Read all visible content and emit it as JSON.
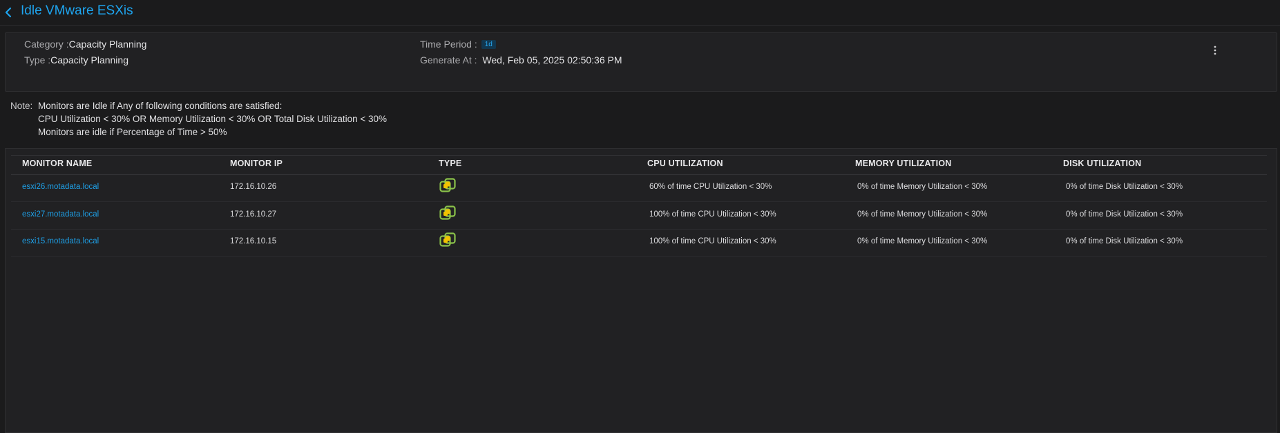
{
  "header": {
    "title": "Idle VMware ESXis"
  },
  "info": {
    "category_label": "Category :",
    "category_value": "Capacity Planning",
    "type_label": "Type :",
    "type_value": "Capacity Planning",
    "time_period_label": "Time Period :",
    "time_period_value": "1d",
    "generated_label": "Generate At :",
    "generated_value": "Wed, Feb 05, 2025 02:50:36 PM"
  },
  "note": {
    "label": "Note:",
    "lines": [
      "Monitors are Idle if Any of following conditions are satisfied:",
      "CPU Utilization < 30% OR Memory Utilization < 30% OR Total Disk Utilization < 30%",
      "Monitors are idle if Percentage of Time > 50%"
    ]
  },
  "table": {
    "columns": [
      "MONITOR NAME",
      "MONITOR IP",
      "TYPE",
      "CPU UTILIZATION",
      "MEMORY UTILIZATION",
      "DISK UTILIZATION"
    ],
    "rows": [
      {
        "name": "esxi26.motadata.local",
        "ip": "172.16.10.26",
        "type_icon": "vmware-icon",
        "cpu": "60% of time CPU Utilization < 30%",
        "memory": "0% of time Memory Utilization < 30%",
        "disk": "0% of time Disk Utilization < 30%"
      },
      {
        "name": "esxi27.motadata.local",
        "ip": "172.16.10.27",
        "type_icon": "vmware-icon",
        "cpu": "100% of time CPU Utilization < 30%",
        "memory": "0% of time Memory Utilization < 30%",
        "disk": "0% of time Disk Utilization < 30%"
      },
      {
        "name": "esxi15.motadata.local",
        "ip": "172.16.10.15",
        "type_icon": "vmware-icon",
        "cpu": "100% of time CPU Utilization < 30%",
        "memory": "0% of time Memory Utilization < 30%",
        "disk": "0% of time Disk Utilization < 30%"
      }
    ]
  },
  "colors": {
    "accent": "#1ea5ef",
    "background": "#1b1b1c",
    "panel": "#212123"
  }
}
